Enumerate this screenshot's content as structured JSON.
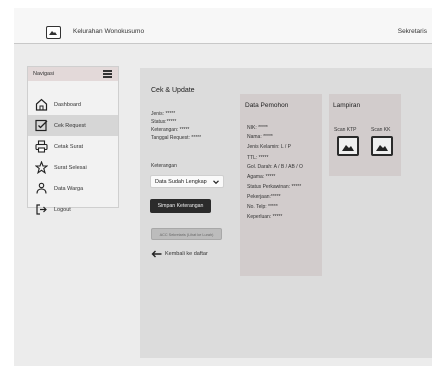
{
  "header": {
    "app_name": "Kelurahan Wonokusumo",
    "role": "Sekretaris"
  },
  "sidebar": {
    "title": "Navigasi",
    "items": [
      {
        "label": "Dashboard",
        "icon": "home-icon",
        "active": false
      },
      {
        "label": "Cek Request",
        "icon": "checklist-icon",
        "active": true
      },
      {
        "label": "Cetak Surat",
        "icon": "printer-icon",
        "active": false
      },
      {
        "label": "Surat Selesai",
        "icon": "star-icon",
        "active": false
      },
      {
        "label": "Data Warga",
        "icon": "users-icon",
        "active": false
      },
      {
        "label": "Logout",
        "icon": "logout-icon",
        "active": false
      }
    ]
  },
  "cek_update": {
    "title": "Cek & Update",
    "jenis": "Jenis: *****",
    "status": "Status:*****",
    "keterangan": "Keterangan: *****",
    "tanggal": "Tanggal Request: *****",
    "keterangan_label": "Keterangan",
    "select_value": "Data Sudah Lengkap",
    "save_button": "Simpan Keterangan",
    "acc_button": "ACC Sekretaris (Lihat ke Lurah)",
    "back_link": "Kembali ke daftar"
  },
  "pemohon": {
    "title": "Data Pemohon",
    "lines": [
      "NIK: *****",
      "Nama: *****",
      "Jenis Kelamin: L / P",
      "TTL: *****",
      "Gol. Darah: A / B / AB / O",
      "Agama: *****",
      "Status Perkawinan: *****",
      "Pekerjaan:*****",
      "No. Telp: *****",
      "Keperluan: *****"
    ]
  },
  "lampiran": {
    "title": "Lampiran",
    "ktp_label": "Scan KTP",
    "kk_label": "Scan KK"
  }
}
